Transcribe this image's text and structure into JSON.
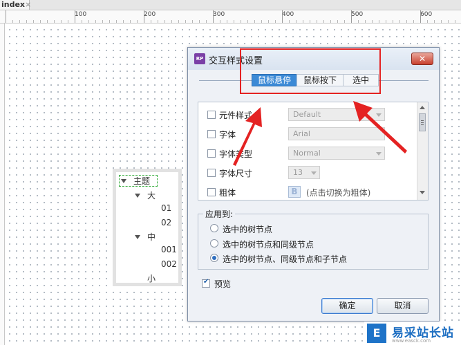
{
  "tabbar": {
    "tab_label": "index",
    "close_glyph": "×"
  },
  "ruler": {
    "labels": [
      "100",
      "200",
      "300",
      "400",
      "500",
      "600"
    ]
  },
  "tree": {
    "nodes": [
      {
        "label": "主题"
      },
      {
        "label": "大"
      },
      {
        "label": "01"
      },
      {
        "label": "02"
      },
      {
        "label": "中"
      },
      {
        "label": "001"
      },
      {
        "label": "002"
      },
      {
        "label": "小"
      }
    ]
  },
  "dialog": {
    "icon_text": "RP",
    "title": "交互样式设置",
    "close_glyph": "✕",
    "tabs": [
      "鼠标悬停",
      "鼠标按下",
      "选中"
    ],
    "active_tab": "鼠标悬停",
    "properties": [
      {
        "label": "元件样式",
        "value": "Default",
        "checked": false
      },
      {
        "label": "字体",
        "value": "Arial",
        "checked": false
      },
      {
        "label": "字体类型",
        "value": "Normal",
        "checked": false
      },
      {
        "label": "字体尺寸",
        "value": "13",
        "checked": false
      },
      {
        "label": "粗体",
        "button": "B",
        "hint": "(点击切换为粗体)",
        "checked": false
      }
    ],
    "apply_to": {
      "title": "应用到:",
      "options": [
        "选中的树节点",
        "选中的树节点和同级节点",
        "选中的树节点、同级节点和子节点"
      ],
      "selected_index": 2
    },
    "preview": {
      "label": "预览",
      "checked": true
    },
    "ok_label": "确定",
    "cancel_label": "取消"
  },
  "watermark": {
    "logo": "E",
    "text": "易采站长站",
    "url": "www.easck.com"
  },
  "colors": {
    "highlight_red": "#e42222",
    "active_tab": "#3c8ad6",
    "tree_selection": "#3cb043"
  }
}
